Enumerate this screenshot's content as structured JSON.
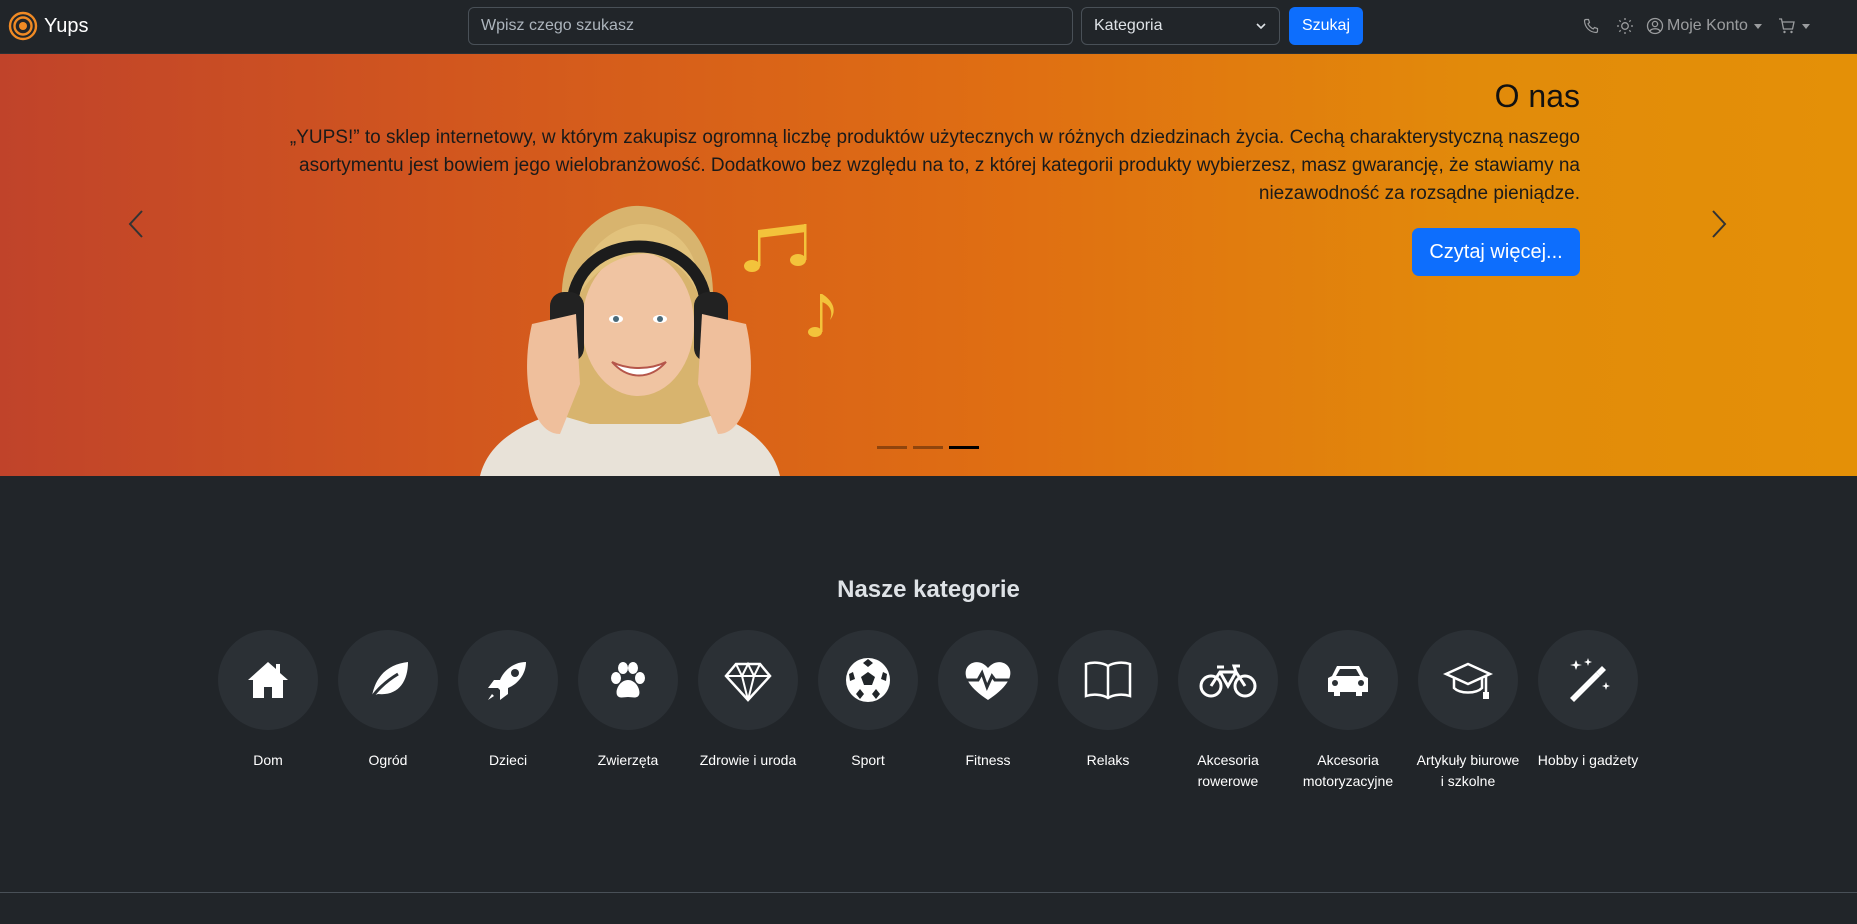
{
  "navbar": {
    "brand_name": "Yups",
    "search_placeholder": "Wpisz czego szukasz",
    "category_select_value": "Kategoria",
    "search_button": "Szukaj",
    "account_label": "Moje Konto"
  },
  "hero": {
    "title": "O nas",
    "text": "„YUPS!” to sklep internetowy, w którym zakupisz ogromną liczbę produktów użytecznych w różnych dziedzinach życia. Cechą charakterystyczną naszego asortymentu jest bowiem jego wielobranżowość. Dodatkowo bez względu na to, z której kategorii produkty wybierzesz, masz gwarancję, że stawiamy na niezawodność za rozsądne pieniądze.",
    "button": "Czytaj więcej...",
    "slides": 3,
    "active_slide": 3
  },
  "categories": {
    "title": "Nasze kategorie",
    "items": [
      {
        "label": "Dom",
        "icon": "house-icon"
      },
      {
        "label": "Ogród",
        "icon": "leaf-icon"
      },
      {
        "label": "Dzieci",
        "icon": "rocket-icon"
      },
      {
        "label": "Zwierzęta",
        "icon": "paw-icon"
      },
      {
        "label": "Zdrowie i uroda",
        "icon": "gem-icon"
      },
      {
        "label": "Sport",
        "icon": "soccer-ball-icon"
      },
      {
        "label": "Fitness",
        "icon": "heart-pulse-icon"
      },
      {
        "label": "Relaks",
        "icon": "book-icon"
      },
      {
        "label": "Akcesoria rowerowe",
        "icon": "bicycle-icon"
      },
      {
        "label": "Akcesoria motoryzacyjne",
        "icon": "car-icon"
      },
      {
        "label": "Artykuły biurowe i szkolne",
        "icon": "graduation-cap-icon"
      },
      {
        "label": "Hobby i gadżety",
        "icon": "magic-wand-icon"
      }
    ]
  },
  "colors": {
    "primary": "#0d6efd",
    "background": "#212529",
    "hero_gradient_start": "#c0432a",
    "hero_gradient_end": "#e49007"
  }
}
